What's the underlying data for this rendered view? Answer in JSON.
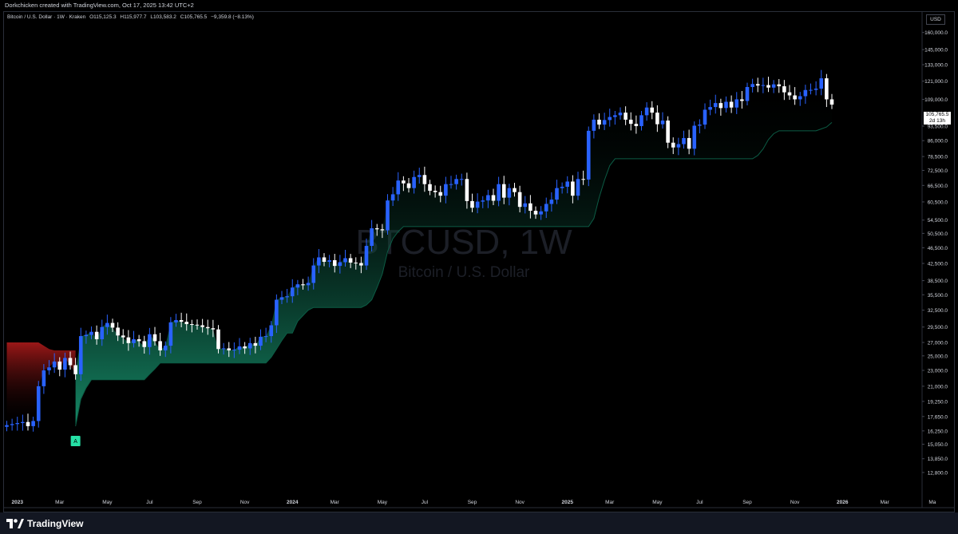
{
  "header": {
    "credit": "Dorkchicken created with TradingView.com, Oct 17, 2025 13:42 UTC+2"
  },
  "legend": {
    "title": "Bitcoin / U.S. Dollar · 1W · Kraken",
    "open": "O115,125.3",
    "high": "H115,977.7",
    "low": "L103,583.2",
    "close": "C105,765.5",
    "change": "−9,359.8 (−8.13%)"
  },
  "currency": "USD",
  "last_price": {
    "value": "105,765.5",
    "countdown": "2d 13h"
  },
  "watermark": {
    "symbol": "BTCUSD, 1W",
    "name": "Bitcoin / U.S. Dollar"
  },
  "signal_marker": {
    "label": "A"
  },
  "footer": {
    "brand": "TradingView"
  },
  "colors": {
    "bull": "#2962ff",
    "bear": "#ffffff",
    "band_up": "#1aa37a",
    "band_down": "#b71c1c",
    "signal": "#26e0a5"
  },
  "chart_data": {
    "type": "candlestick",
    "scale": "log",
    "ylim": [
      11000,
      180000
    ],
    "y_ticks": [
      "175,000.0",
      "160,000.0",
      "145,000.0",
      "133,000.0",
      "121,000.0",
      "109,000.0",
      "93,500.0",
      "86,000.0",
      "78,500.0",
      "72,500.0",
      "66,500.0",
      "60,500.0",
      "54,500.0",
      "50,500.0",
      "46,500.0",
      "42,500.0",
      "38,500.0",
      "35,500.0",
      "32,500.0",
      "29,500.0",
      "27,000.0",
      "25,000.0",
      "23,000.0",
      "21,000.0",
      "19,250.0",
      "17,650.0",
      "16,250.0",
      "15,050.0",
      "13,850.0",
      "12,800.0"
    ],
    "x_ticks": [
      {
        "week": 2,
        "label": "2023"
      },
      {
        "week": 10,
        "label": "Mar"
      },
      {
        "week": 19,
        "label": "May"
      },
      {
        "week": 27,
        "label": "Jul"
      },
      {
        "week": 36,
        "label": "Sep"
      },
      {
        "week": 45,
        "label": "Nov"
      },
      {
        "week": 54,
        "label": "2024"
      },
      {
        "week": 62,
        "label": "Mar"
      },
      {
        "week": 71,
        "label": "May"
      },
      {
        "week": 79,
        "label": "Jul"
      },
      {
        "week": 88,
        "label": "Sep"
      },
      {
        "week": 97,
        "label": "Nov"
      },
      {
        "week": 106,
        "label": "2025"
      },
      {
        "week": 114,
        "label": "Mar"
      },
      {
        "week": 123,
        "label": "May"
      },
      {
        "week": 131,
        "label": "Jul"
      },
      {
        "week": 140,
        "label": "Sep"
      },
      {
        "week": 149,
        "label": "Nov"
      },
      {
        "week": 158,
        "label": "2026"
      },
      {
        "week": 166,
        "label": "Mar"
      },
      {
        "week": 175,
        "label": "Ma"
      }
    ],
    "weekly_closes": [
      16800,
      16900,
      17000,
      17100,
      16700,
      17200,
      21000,
      23000,
      23400,
      24200,
      23100,
      24700,
      23700,
      22500,
      28000,
      28200,
      28700,
      27500,
      29500,
      30200,
      29400,
      28100,
      27800,
      26900,
      27500,
      27200,
      26300,
      28300,
      27200,
      25800,
      26500,
      30300,
      30700,
      30400,
      30000,
      29900,
      29800,
      29500,
      29300,
      29100,
      26000,
      26100,
      25800,
      25900,
      26400,
      26100,
      26900,
      26500,
      27900,
      28000,
      29800,
      34500,
      35000,
      35200,
      37000,
      37700,
      37500,
      38000,
      42000,
      44000,
      42900,
      43300,
      41900,
      42800,
      43800,
      42700,
      42600,
      42000,
      47000,
      52000,
      51700,
      51400,
      61000,
      63200,
      68400,
      67300,
      65500,
      69800,
      70600,
      67000,
      64500,
      64000,
      62700,
      67000,
      67000,
      69000,
      69000,
      60800,
      58500,
      60600,
      61000,
      62900,
      60900,
      67000,
      62000,
      65500,
      64000,
      58800,
      60000,
      57500,
      56300,
      57300,
      59800,
      61300,
      65500,
      66000,
      68000,
      62700,
      69000,
      68800,
      91000,
      97000,
      94300,
      96800,
      98500,
      99500,
      101000,
      97000,
      94700,
      93500,
      99500,
      104000,
      101000,
      94500,
      96500,
      85000,
      82700,
      84300,
      87300,
      82100,
      93700,
      94300,
      102700,
      104300,
      106700,
      103700,
      107500,
      104000,
      109000,
      108000,
      117000,
      119000,
      118000,
      118300,
      116600,
      118800,
      117500,
      113500,
      111500,
      109000,
      111000,
      115000,
      115100,
      115900,
      123000,
      109000,
      105765.5
    ],
    "band_support": [
      16700,
      16700,
      16700,
      16700,
      16700,
      16700,
      16700,
      16700,
      16700,
      16700,
      16700,
      16700,
      16700,
      16700,
      19500,
      20800,
      21800,
      21800,
      21800,
      21800,
      21800,
      21800,
      21800,
      21800,
      21800,
      21800,
      21800,
      22500,
      23200,
      24000,
      24000,
      24000,
      24000,
      24000,
      24000,
      24000,
      24000,
      24000,
      24000,
      24000,
      24000,
      24000,
      24000,
      24000,
      24000,
      24000,
      24000,
      24000,
      24000,
      24000,
      24800,
      26000,
      27300,
      28500,
      28500,
      30500,
      31500,
      32500,
      33000,
      33000,
      33000,
      33000,
      33000,
      33000,
      33000,
      33000,
      33000,
      33000,
      33500,
      34500,
      37000,
      40000,
      45500,
      49000,
      51000,
      52500,
      52500,
      52500,
      52500,
      52500,
      52500,
      52500,
      52500,
      52500,
      52500,
      52500,
      52500,
      52500,
      52500,
      52500,
      52500,
      52500,
      52500,
      52500,
      52500,
      52500,
      52500,
      52500,
      52500,
      52500,
      52500,
      52500,
      52500,
      52500,
      52500,
      52500,
      52500,
      52500,
      52500,
      52500,
      52500,
      55000,
      62000,
      68500,
      74500,
      77500,
      77500,
      77500,
      77500,
      77500,
      77500,
      77500,
      77500,
      77500,
      77500,
      77500,
      77500,
      77500,
      77500,
      77500,
      77500,
      77500,
      77500,
      77500,
      77500,
      77500,
      77500,
      77500,
      77500,
      77500,
      77500,
      77500,
      79000,
      82000,
      86500,
      89500,
      91000,
      91000,
      91000,
      91000,
      91000,
      91000,
      91000,
      91000,
      92000,
      93000,
      95500,
      97500,
      97500,
      97500,
      97500,
      97500
    ],
    "band_resistance_bear": [
      27000,
      27000,
      27000,
      27000,
      27000,
      27000,
      27000,
      26500,
      26000,
      25800,
      25800,
      25800,
      25800,
      25800
    ],
    "signal_week": 13
  }
}
